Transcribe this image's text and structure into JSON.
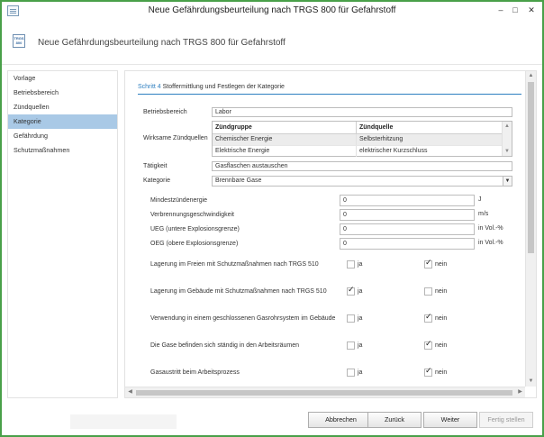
{
  "window": {
    "title": "Neue Gefährdungsbeurteilung nach TRGS 800 für Gefahrstoff",
    "min": "–",
    "max": "□",
    "close": "✕"
  },
  "header": {
    "icon_text": "TRGS 800",
    "title": "Neue Gefährdungsbeurteilung nach TRGS 800 für Gefahrstoff"
  },
  "sidebar": {
    "items": [
      {
        "label": "Vorlage",
        "active": false
      },
      {
        "label": "Betriebsbereich",
        "active": false
      },
      {
        "label": "Zündquellen",
        "active": false
      },
      {
        "label": "Kategorie",
        "active": true
      },
      {
        "label": "Gefährdung",
        "active": false
      },
      {
        "label": "Schutzmaßnahmen",
        "active": false
      }
    ]
  },
  "step": {
    "label": "Schritt 4",
    "title": "Stoffermittlung und Festlegen der Kategorie"
  },
  "form": {
    "betriebsbereich_label": "Betriebsbereich",
    "betriebsbereich_value": "Labor",
    "zuendquellen_label": "Wirksame Zündquellen",
    "grid": {
      "headers": [
        "Zündgruppe",
        "Zündquelle"
      ],
      "rows": [
        [
          "Chemischer Energie",
          "Selbsterhitzung"
        ],
        [
          "Elektrische Energie",
          "elektrischer Kurzschluss"
        ]
      ]
    },
    "taetigkeit_label": "Tätigkeit",
    "taetigkeit_value": "Gasflaschen austauschen",
    "kategorie_label": "Kategorie",
    "kategorie_value": "Brennbare Gase",
    "numeric": [
      {
        "label": "Mindestzündenergie",
        "value": "0",
        "unit": "J"
      },
      {
        "label": "Verbrennungsgeschwindigkeit",
        "value": "0",
        "unit": "m/s"
      },
      {
        "label": "UEG (untere Explosionsgrenze)",
        "value": "0",
        "unit": "in Vol.-%"
      },
      {
        "label": "OEG (obere Explosionsgrenze)",
        "value": "0",
        "unit": "in Vol.-%"
      }
    ],
    "yes_label": "ja",
    "no_label": "nein",
    "questions": [
      {
        "label": "Lagerung im Freien mit Schutzmaßnahmen nach TRGS 510",
        "ja": false,
        "nein": true
      },
      {
        "label": "Lagerung im Gebäude mit Schutzmaßnahmen nach TRGS 510",
        "ja": true,
        "nein": false
      },
      {
        "label": "Verwendung in einem geschlossenen Gasrohrsystem im Gebäude",
        "ja": false,
        "nein": true
      },
      {
        "label": "Die Gase befinden sich ständig in den Arbeitsräumen",
        "ja": false,
        "nein": true
      },
      {
        "label": "Gasaustritt beim Arbeitsprozess",
        "ja": false,
        "nein": true
      }
    ]
  },
  "buttons": {
    "cancel": "Abbrechen",
    "back": "Zurück",
    "next": "Weiter",
    "finish": "Fertig stellen"
  },
  "colors": {
    "accent": "#2e7fc0",
    "active_nav": "#a9c9e6",
    "frame": "#49a049"
  }
}
